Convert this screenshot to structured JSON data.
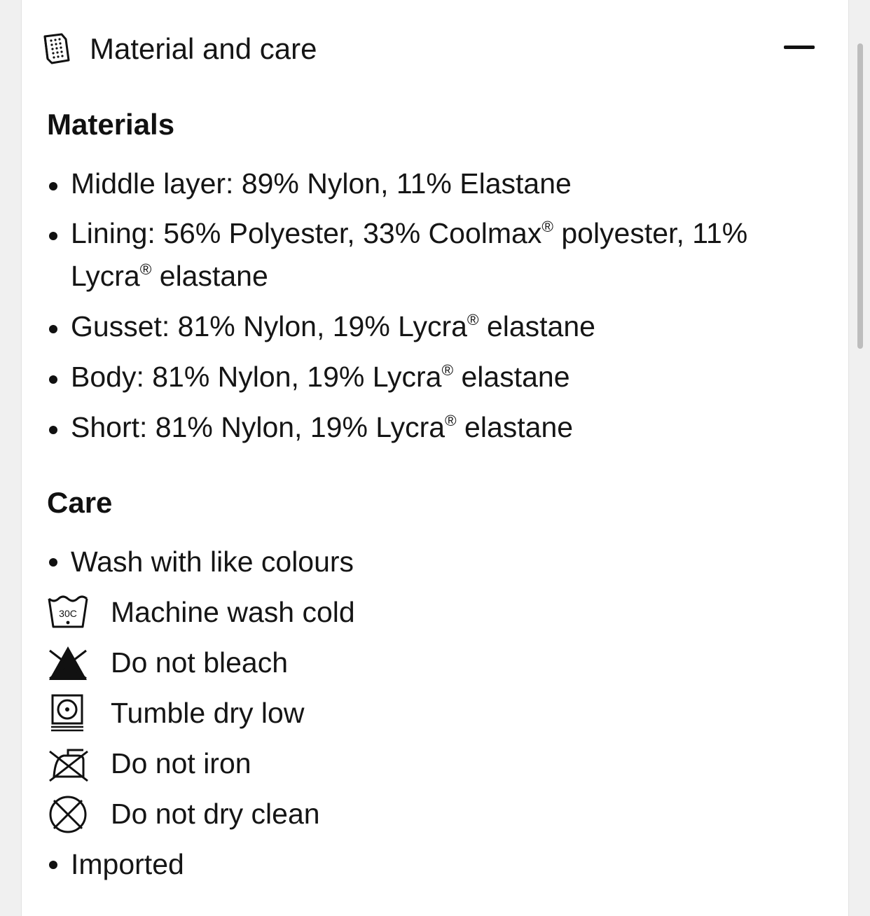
{
  "accordion": {
    "title": "Material and care",
    "header_icon": "fabric-swatch-icon",
    "toggle_icon": "minus-icon"
  },
  "materials": {
    "heading": "Materials",
    "items": [
      "Middle layer: 89% Nylon, 11% Elastane",
      "Lining: 56% Polyester, 33% Coolmax® polyester, 11% Lycra® elastane",
      "Gusset: 81% Nylon, 19% Lycra® elastane",
      "Body: 81% Nylon, 19% Lycra® elastane",
      "Short: 81% Nylon, 19% Lycra® elastane"
    ]
  },
  "care": {
    "heading": "Care",
    "items": [
      {
        "icon": "bullet",
        "label": "Wash with like colours"
      },
      {
        "icon": "machine-wash-30c-icon",
        "label": "Machine wash cold",
        "icon_text": "30C"
      },
      {
        "icon": "do-not-bleach-icon",
        "label": "Do not bleach"
      },
      {
        "icon": "tumble-dry-low-icon",
        "label": "Tumble dry low"
      },
      {
        "icon": "do-not-iron-icon",
        "label": "Do not iron"
      },
      {
        "icon": "do-not-dry-clean-icon",
        "label": "Do not dry clean"
      },
      {
        "icon": "bullet",
        "label": "Imported"
      }
    ]
  }
}
